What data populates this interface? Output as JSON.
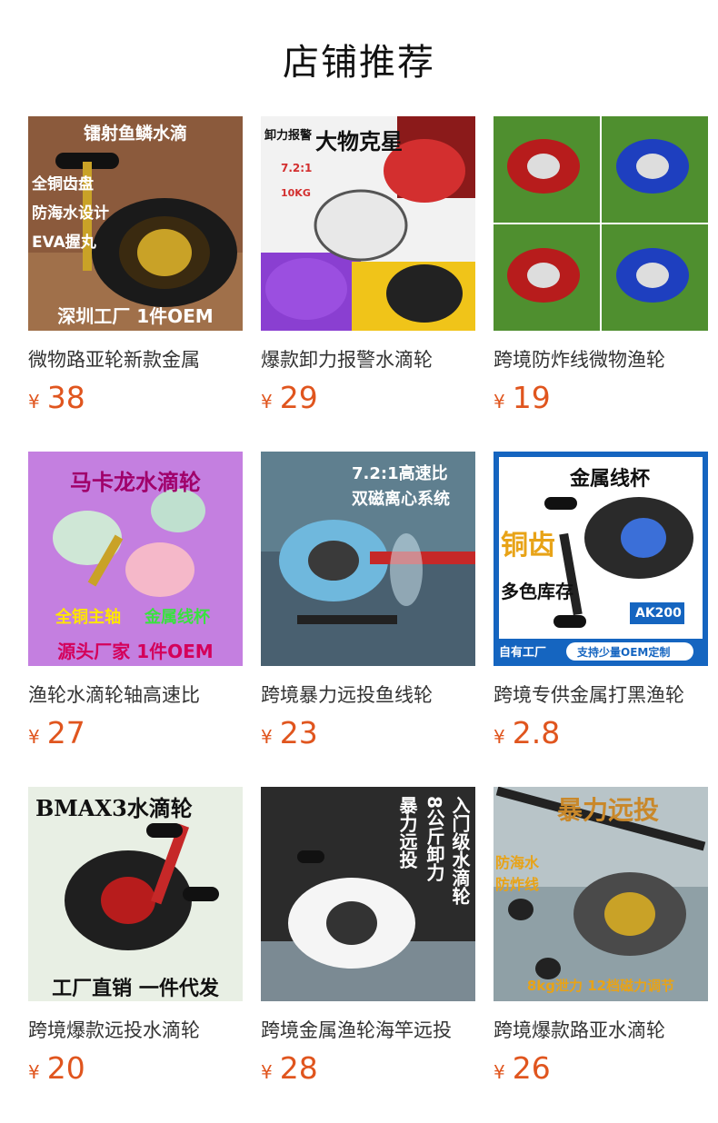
{
  "header": {
    "title": "店铺推荐"
  },
  "colors": {
    "price": "#e0551e",
    "title": "#111111"
  },
  "products": [
    {
      "name": "微物路亚轮新款金属",
      "currency": "¥",
      "price": "38",
      "image_text": [
        "镭射鱼鳞水滴",
        "全铜齿盘",
        "防海水设计",
        "EVA握丸",
        "深圳工厂 1件OEM"
      ]
    },
    {
      "name": "爆款卸力报警水滴轮",
      "currency": "¥",
      "price": "29",
      "image_text": [
        "大物克星",
        "卸力报警",
        "7.2:1",
        "10KG"
      ]
    },
    {
      "name": "跨境防炸线微物渔轮",
      "currency": "¥",
      "price": "19",
      "image_text": []
    },
    {
      "name": "渔轮水滴轮轴高速比",
      "currency": "¥",
      "price": "27",
      "image_text": [
        "马卡龙水滴轮",
        "全铜主轴",
        "金属线杯",
        "源头厂家 1件OEM"
      ]
    },
    {
      "name": "跨境暴力远投鱼线轮",
      "currency": "¥",
      "price": "23",
      "image_text": [
        "7.2:1高速比",
        "双磁离心系统"
      ]
    },
    {
      "name": "跨境专供金属打黑渔轮",
      "currency": "¥",
      "price": "2.8",
      "image_text": [
        "金属线杯",
        "铜齿",
        "多色库存",
        "AK200",
        "自有工厂",
        "支持少量OEM定制"
      ]
    },
    {
      "name": "跨境爆款远投水滴轮",
      "currency": "¥",
      "price": "20",
      "image_text": [
        "BMAX3水滴轮",
        "工厂直销 一件代发"
      ]
    },
    {
      "name": "跨境金属渔轮海竿远投",
      "currency": "¥",
      "price": "28",
      "image_text": [
        "入门级水滴轮",
        "8公斤卸力",
        "暴力远投"
      ]
    },
    {
      "name": "跨境爆款路亚水滴轮",
      "currency": "¥",
      "price": "26",
      "image_text": [
        "暴力远投",
        "防海水",
        "防炸线",
        "8kg泄力 12档磁力调节"
      ]
    }
  ]
}
